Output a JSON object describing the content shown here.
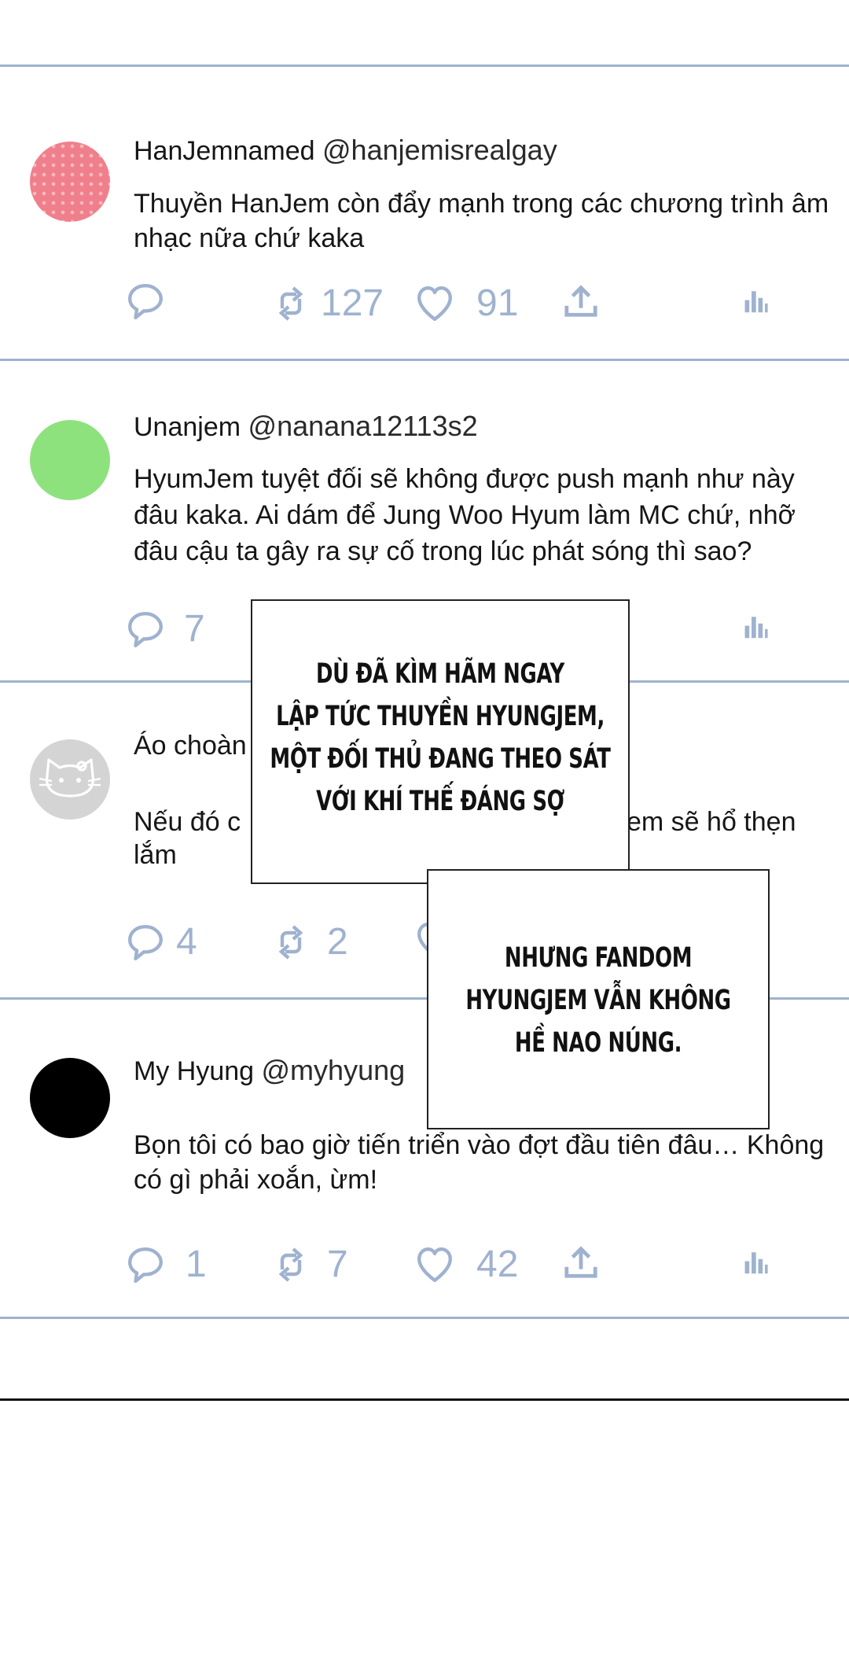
{
  "posts": [
    {
      "name": "HanJemnamed",
      "handle": "@hanjemisrealgay",
      "text": "Thuyền HanJem còn đẩy mạnh trong các chương trình âm nhạc nữa chứ kaka",
      "retweets": "127",
      "likes": "91"
    },
    {
      "name": "Unanjem",
      "handle": "@nanana12113s2",
      "text": "HyumJem tuyệt đối sẽ không được push mạnh như này đâu kaka. Ai dám để Jung Woo Hyum làm MC chứ, nhỡ đâu cậu ta gây ra sự cố trong lúc phát sóng thì sao?",
      "replies": "7"
    },
    {
      "name": "Áo choàn",
      "text_left": "Nếu đó c",
      "text_right": "em sẽ hổ thẹn",
      "text_line2": "lắm",
      "replies": "4",
      "retweets": "2"
    },
    {
      "name": "My Hyung",
      "handle": "@myhyung",
      "text": "Bọn tôi có bao giờ tiến triển vào đợt đầu tiên đâu… Không có gì phải xoắn, ừm!",
      "replies": "1",
      "retweets": "7",
      "likes": "42"
    }
  ],
  "captions": {
    "box1_lines": [
      "DÙ ĐÃ KÌM HÃM NGAY",
      "LẬP TỨC THUYỀN HYUNGJEM,",
      "MỘT ĐỐI THỦ ĐANG THEO SÁT",
      "VỚI KHÍ THẾ ĐÁNG SỢ"
    ],
    "box2_lines": [
      "NHƯNG FANDOM",
      "HYUNGJEM VẪN KHÔNG",
      "HỀ NAO NÚNG."
    ]
  },
  "colors": {
    "accent": "#9fb2cf",
    "text": "#161616",
    "avatar_1": "#f07f8c",
    "avatar_2": "#8ee27e",
    "avatar_3": "#d4d4d4",
    "avatar_4": "#000000"
  },
  "icons": [
    "reply-icon",
    "retweet-icon",
    "like-icon",
    "share-icon",
    "analytics-icon",
    "hello-kitty-icon"
  ]
}
